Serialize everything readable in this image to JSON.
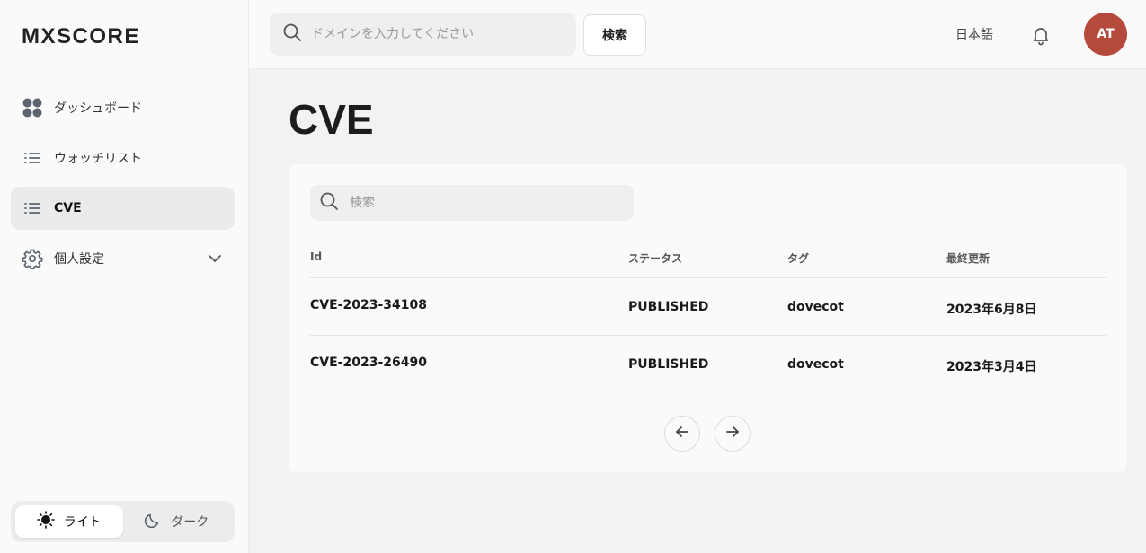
{
  "app": {
    "logo": "MXSCORE"
  },
  "sidebar": {
    "items": [
      {
        "label": "ダッシュボード",
        "icon": "dashboard-icon"
      },
      {
        "label": "ウォッチリスト",
        "icon": "list-icon"
      },
      {
        "label": "CVE",
        "icon": "list-icon",
        "active": true
      },
      {
        "label": "個人設定",
        "icon": "gear-icon",
        "expandable": true
      }
    ],
    "theme": {
      "light": "ライト",
      "dark": "ダーク",
      "selected": "light"
    }
  },
  "topbar": {
    "search_placeholder": "ドメインを入力してください",
    "search_button": "検索",
    "language": "日本語",
    "avatar_initials": "AT"
  },
  "main": {
    "title": "CVE",
    "table": {
      "search_placeholder": "検索",
      "columns": [
        "Id",
        "ステータス",
        "タグ",
        "最終更新"
      ],
      "rows": [
        {
          "id": "CVE-2023-34108",
          "status": "PUBLISHED",
          "tag": "dovecot",
          "updated": "2023年6月8日"
        },
        {
          "id": "CVE-2023-26490",
          "status": "PUBLISHED",
          "tag": "dovecot",
          "updated": "2023年3月4日"
        }
      ]
    }
  },
  "colors": {
    "avatar": "#b54a3c",
    "active_nav": "#ebebeb"
  }
}
